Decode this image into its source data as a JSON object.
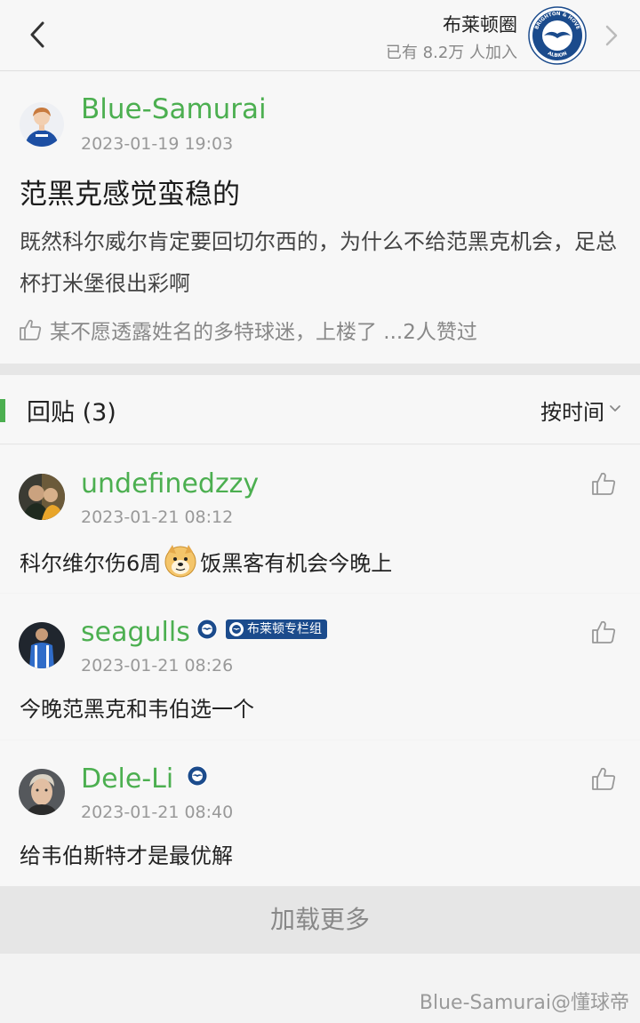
{
  "header": {
    "circle_name": "布莱顿圈",
    "members_text": "已有 8.2万 人加入",
    "badge_icon": "brighton-badge-icon",
    "badge_ring_text_top": "BRIGHTON & HOVE",
    "badge_ring_text_bottom": "ALBION"
  },
  "post": {
    "author": "Blue-Samurai",
    "time": "2023-01-19 19:03",
    "title": "范黑克感觉蛮稳的",
    "body": "既然科尔威尔肯定要回切尔西的，为什么不给范黑克机会，足总杯打米堡很出彩啊",
    "likes_text": "某不愿透露姓名的多特球迷，上楼了 ...2人赞过"
  },
  "replies_section": {
    "title": "回贴 (3)",
    "sort_label": "按时间"
  },
  "replies": [
    {
      "author": "undefinedzzy",
      "time": "2023-01-21 08:12",
      "body_before": "科尔维尔伤6周",
      "emoji": "doge-emoji",
      "body_after": "饭黑客有机会今晚上"
    },
    {
      "author": "seagulls",
      "time": "2023-01-21 08:26",
      "column_badge": "布莱顿专栏组",
      "body": "今晚范黑克和韦伯选一个"
    },
    {
      "author": "Dele-Li",
      "time": "2023-01-21 08:40",
      "body": "给韦伯斯特才是最优解"
    }
  ],
  "load_more": "加载更多",
  "watermark": "Blue-Samurai@懂球帝",
  "colors": {
    "accent_green": "#4caf50",
    "brighton_blue": "#1b4b8c",
    "background": "#f7f7f7",
    "divider": "#e6e6e6"
  }
}
